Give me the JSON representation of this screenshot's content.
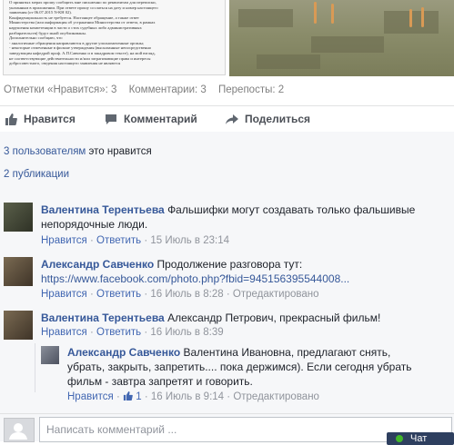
{
  "document": {
    "lines": [
      "О принятых мерах прошу сообщить мне письменно по реквизитам для переписки,",
      "указанным в приложении. При ответе прошу сослаться на дату и номер настоящего",
      "заявления (от 06.07.2015 N-КН 02).",
      "Конфиденциальность не требуется. Настоящее обращение, а также ответ",
      "Министерства (или информация об устранении Министерства от ответа, в рамках",
      "нарушения компетенции в части о стих судебных либо административных",
      "разбирательств) будут мной опубликованы.",
      "Дополнительно сообщаю, что",
      "- аналогичные обращения направляются в другие уполномоченные органы;",
      "- некоторые отмеченные в фильме утверждения (высказанные непосредственно",
      "заведующим кафедрой проф. А.П.Савченко и в закадровом тексте), на мой взгляд,",
      "не соответствующие действительности и/или затрагивающие права и интересы",
      "добросовестного, сведения настоящего заявления не являются"
    ]
  },
  "stats": {
    "likes": "Отметки «Нравится»: 3",
    "comments": "Комментарии: 3",
    "shares": "Перепосты: 2"
  },
  "actions": {
    "like": "Нравится",
    "comment": "Комментарий",
    "share": "Поделиться"
  },
  "summary": {
    "likes_link": "3 пользователям",
    "likes_rest": "это нравится",
    "shares": "2 публикации"
  },
  "comments": [
    {
      "author": "Валентина Терентьева",
      "text_line1": "Фальшифки могут создавать только фальшивые",
      "text_line2": "непорядочные люди.",
      "like": "Нравится",
      "reply": "Ответить",
      "time": "15 Июль в 23:14"
    },
    {
      "author": "Александр Савченко",
      "text_line1": "Продолжение разговора тут:",
      "link": "https://www.facebook.com/photo.php?fbid=945156395544008...",
      "like": "Нравится",
      "reply": "Ответить",
      "time": "16 Июль в 8:28",
      "edited": "Отредактировано"
    },
    {
      "author": "Валентина Терентьева",
      "text_line1": "Александр Петрович, прекрасный фильм!",
      "like": "Нравится",
      "reply": "Ответить",
      "time": "16 Июль в 8:39"
    },
    {
      "author": "Александр Савченко",
      "text_line1": "Валентина Ивановна, предлагают снять,",
      "text_line2": "убрать, закрыть, запретить.... пока держимся). Если сегодня убрать",
      "text_line3": "фильм - завтра запретят и говорить.",
      "like": "Нравится",
      "like_count": "1",
      "reply": "Ответить",
      "time": "16 Июль в 9:14",
      "edited": "Отредактировано"
    }
  ],
  "input": {
    "placeholder": "Написать комментарий ..."
  },
  "popup": {
    "label": "Чат"
  },
  "separator": "·"
}
